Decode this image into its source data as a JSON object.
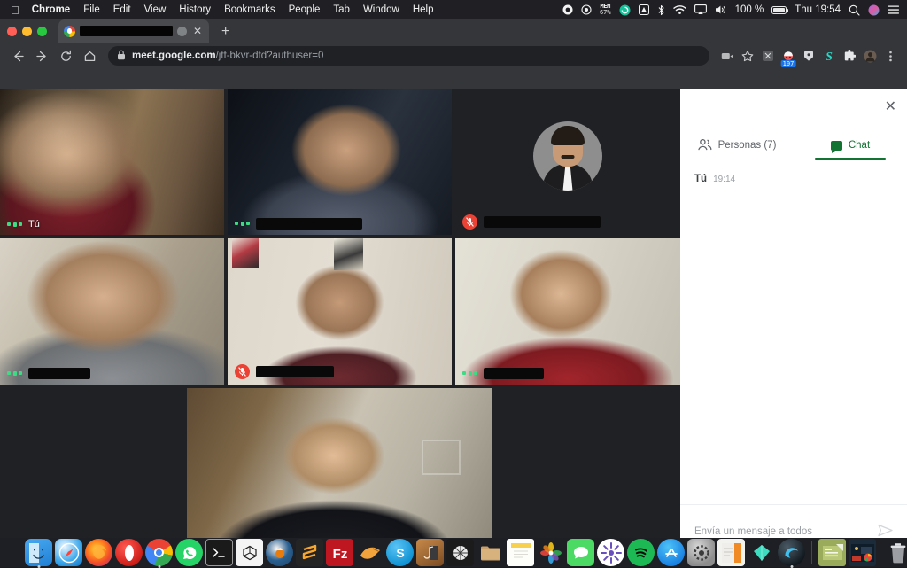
{
  "menubar": {
    "apple_icon": "apple-logo",
    "items": [
      {
        "label": "Chrome",
        "bold": true
      },
      {
        "label": "File",
        "bold": false
      },
      {
        "label": "Edit",
        "bold": false
      },
      {
        "label": "View",
        "bold": false
      },
      {
        "label": "History",
        "bold": false
      },
      {
        "label": "Bookmarks",
        "bold": false
      },
      {
        "label": "People",
        "bold": false
      },
      {
        "label": "Tab",
        "bold": false
      },
      {
        "label": "Window",
        "bold": false
      },
      {
        "label": "Help",
        "bold": false
      }
    ],
    "status": {
      "mem_label": "MEM",
      "mem_value": "67%",
      "volume_percent": "100 %",
      "clock": "Thu 19:54",
      "icons": [
        "record-icon",
        "location-icon",
        "memory-monitor-icon",
        "grammarly-icon",
        "drive-icon",
        "bluetooth-icon",
        "wifi-icon",
        "airplay-icon",
        "volume-icon",
        "battery-icon",
        "spotlight-search-icon",
        "siri-icon",
        "control-center-icon"
      ]
    }
  },
  "browser": {
    "tab": {
      "title_redacted": true,
      "audio_icon": "audio-playing-icon",
      "close_icon": "close-icon",
      "favicon": "google-meet-favicon"
    },
    "new_tab_label": "+",
    "nav": {
      "back_icon": "back-arrow-icon",
      "forward_icon": "forward-arrow-icon",
      "reload_icon": "reload-icon",
      "home_icon": "home-icon"
    },
    "omnibox": {
      "lock_icon": "lock-icon",
      "url_domain": "meet.google.com",
      "url_path": "/jtf-bkvr-dfd?authuser=0"
    },
    "toolbar_right": {
      "media_icon": "camera-video-icon",
      "bookmark_icon": "star-icon",
      "ext_screenshot_icon": "screenshot-extension-icon",
      "ext_badge_icon": "notification-extension-icon",
      "ext_badge_count": "107",
      "ext_pocket_icon": "pocket-extension-icon",
      "ext_s_icon": "grammarly-s-icon",
      "ext_puzzle_icon": "extensions-puzzle-icon",
      "profile_icon": "profile-avatar-icon",
      "menu_icon": "three-dot-menu-icon"
    }
  },
  "meet": {
    "tiles": [
      {
        "id": "tile-self",
        "name": "Tú",
        "name_redacted": false,
        "muted": false,
        "speaking_dots": true,
        "avatar": false
      },
      {
        "id": "tile-2",
        "name": "",
        "name_redacted": true,
        "muted": false,
        "speaking_dots": true,
        "avatar": false
      },
      {
        "id": "tile-3",
        "name": "",
        "name_redacted": true,
        "muted": true,
        "speaking_dots": false,
        "avatar": true
      },
      {
        "id": "tile-4",
        "name": "",
        "name_redacted": true,
        "muted": false,
        "speaking_dots": true,
        "avatar": false
      },
      {
        "id": "tile-5",
        "name": "",
        "name_redacted": true,
        "muted": true,
        "speaking_dots": false,
        "avatar": false
      },
      {
        "id": "tile-6",
        "name": "",
        "name_redacted": true,
        "muted": false,
        "speaking_dots": true,
        "avatar": false
      },
      {
        "id": "tile-7",
        "name": "",
        "name_redacted": true,
        "muted": false,
        "speaking_dots": true,
        "avatar": false
      }
    ],
    "panel": {
      "close_icon": "close-icon",
      "tab_people_label": "Personas (7)",
      "tab_people_icon": "people-icon",
      "tab_chat_label": "Chat",
      "tab_chat_icon": "chat-bubble-icon",
      "active_tab": "Chat",
      "accent_color": "#137333",
      "messages": [
        {
          "author": "Tú",
          "time": "19:14",
          "text_redacted": true
        }
      ],
      "composer_placeholder": "Envía un mensaje a todos",
      "send_icon": "send-icon"
    }
  },
  "dock": {
    "items": [
      {
        "name": "finder",
        "running": true
      },
      {
        "name": "safari",
        "running": false
      },
      {
        "name": "firefox",
        "running": false
      },
      {
        "name": "opera",
        "running": false
      },
      {
        "name": "chrome",
        "running": true
      },
      {
        "name": "whatsapp",
        "running": false
      },
      {
        "name": "terminal",
        "running": false
      },
      {
        "name": "unity",
        "running": false
      },
      {
        "name": "blender",
        "running": false
      },
      {
        "name": "sublime-text",
        "running": false
      },
      {
        "name": "filezilla",
        "running": false
      },
      {
        "name": "shotcut",
        "running": false
      },
      {
        "name": "skype",
        "running": false
      },
      {
        "name": "garageband",
        "running": false
      },
      {
        "name": "vlc",
        "running": false
      },
      {
        "name": "folder",
        "running": false
      },
      {
        "name": "notes",
        "running": false
      },
      {
        "name": "photos",
        "running": false
      },
      {
        "name": "messages",
        "running": false
      },
      {
        "name": "photo-app",
        "running": false
      },
      {
        "name": "spotify",
        "running": false
      },
      {
        "name": "app-store",
        "running": false
      },
      {
        "name": "system-preferences",
        "running": false
      },
      {
        "name": "keynote",
        "running": false
      },
      {
        "name": "sketch",
        "running": false
      },
      {
        "name": "microsoft-edge",
        "running": true
      }
    ],
    "stack_items": [
      {
        "name": "documents-stack"
      },
      {
        "name": "downloads-stack"
      }
    ],
    "trash": {
      "name": "trash"
    }
  }
}
